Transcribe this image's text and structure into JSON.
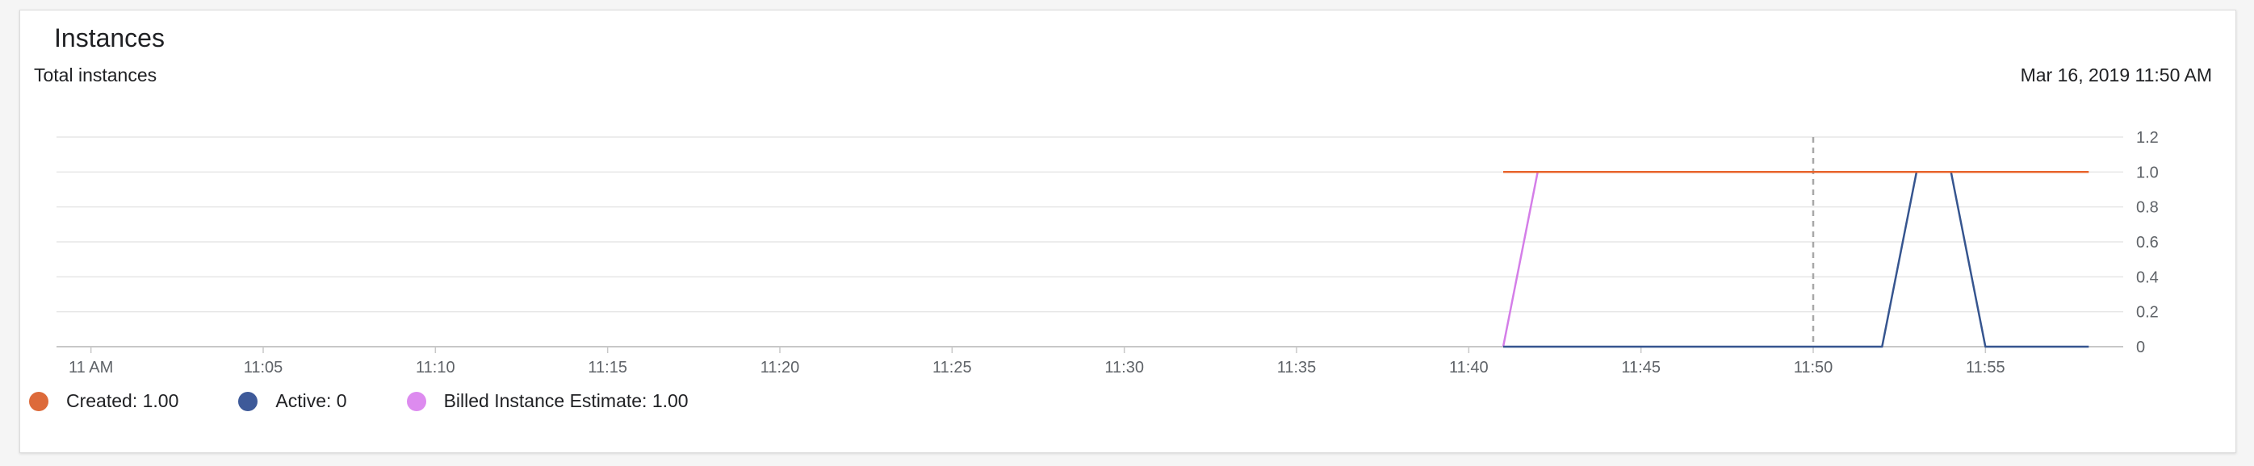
{
  "card": {
    "title": "Instances"
  },
  "chart_data": {
    "type": "line",
    "title": "Total instances",
    "timestamp": "Mar 16, 2019 11:50 AM",
    "x_ticks": [
      "11 AM",
      "11:05",
      "11:10",
      "11:15",
      "11:20",
      "11:25",
      "11:30",
      "11:35",
      "11:40",
      "11:45",
      "11:50",
      "11:55"
    ],
    "x_tick_minutes": [
      0,
      5,
      10,
      15,
      20,
      25,
      30,
      35,
      40,
      45,
      50,
      55
    ],
    "x_range_minutes": [
      -1,
      59
    ],
    "y_ticks": [
      "0",
      "0.2",
      "0.4",
      "0.6",
      "0.8",
      "1.0",
      "1.2"
    ],
    "y_tick_values": [
      0,
      0.2,
      0.4,
      0.6,
      0.8,
      1.0,
      1.2
    ],
    "ylim": [
      0,
      1.2
    ],
    "y_axis_side": "right",
    "grid": true,
    "cursor_minute": 50,
    "legend_position": "bottom-left",
    "series": [
      {
        "name": "Created",
        "legend_value": "1.00",
        "color": "#e8642c",
        "dot_color": "#dd6a3a",
        "points": [
          [
            41,
            1.0
          ],
          [
            58,
            1.0
          ]
        ]
      },
      {
        "name": "Active",
        "legend_value": "0",
        "color": "#36558f",
        "dot_color": "#3e5a99",
        "points": [
          [
            41,
            0
          ],
          [
            52,
            0
          ],
          [
            53,
            1.0
          ],
          [
            54,
            1.0
          ],
          [
            55,
            0
          ],
          [
            58,
            0
          ]
        ]
      },
      {
        "name": "Billed Instance Estimate",
        "legend_value": "1.00",
        "color": "#d47ee8",
        "dot_color": "#dd8bef",
        "points": [
          [
            41,
            0
          ],
          [
            42,
            1.0
          ]
        ]
      }
    ]
  }
}
